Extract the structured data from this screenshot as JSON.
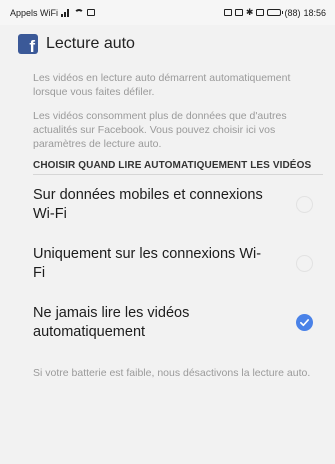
{
  "status_bar": {
    "carrier": "Appels WiFi",
    "right_indicators": "(88)",
    "time": "18:56"
  },
  "app_bar": {
    "logo_letter": "f",
    "title": "Lecture auto"
  },
  "info": {
    "paragraph1": "Les vidéos en lecture auto démarrent automatiquement lorsque vous faites défiler.",
    "paragraph2": "Les vidéos consomment plus de données que d'autres actualités sur Facebook. Vous pouvez choisir ici vos paramètres de lecture auto."
  },
  "section_header": "CHOISIR QUAND LIRE AUTOMATIQUEMENT LES VIDÉOS",
  "options": [
    {
      "label": "Sur données mobiles et connexions Wi-Fi",
      "selected": false
    },
    {
      "label": "Uniquement sur les connexions Wi-Fi",
      "selected": false
    },
    {
      "label": "Ne jamais lire les vidéos automatiquement",
      "selected": true
    }
  ],
  "footer_note": "Si votre batterie est faible, nous désactivons la lecture auto.",
  "colors": {
    "accent": "#4a82e8",
    "facebook_blue": "#3b5998",
    "background": "#f2f2f2"
  }
}
